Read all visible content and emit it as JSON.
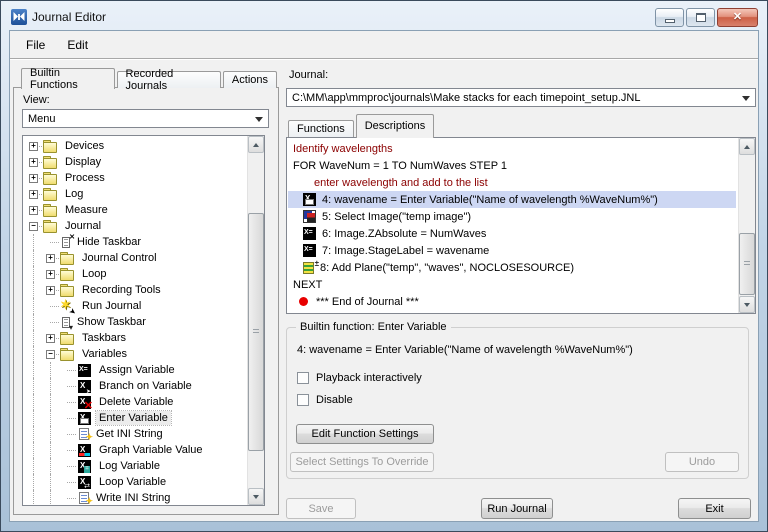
{
  "window": {
    "title": "Journal Editor"
  },
  "menu_bar": {
    "items": [
      "File",
      "Edit"
    ]
  },
  "left_panel": {
    "tabs": [
      {
        "label": "Builtin Functions",
        "active": true
      },
      {
        "label": "Recorded Journals",
        "active": false
      },
      {
        "label": "Actions",
        "active": false
      }
    ],
    "view_label": "View:",
    "view_value": "Menu",
    "tree": [
      {
        "label": "Devices",
        "type": "folder",
        "expand": "+",
        "level": 0
      },
      {
        "label": "Display",
        "type": "folder",
        "expand": "+",
        "level": 0
      },
      {
        "label": "Process",
        "type": "folder",
        "expand": "+",
        "level": 0
      },
      {
        "label": "Log",
        "type": "folder",
        "expand": "+",
        "level": 0
      },
      {
        "label": "Measure",
        "type": "folder",
        "expand": "+",
        "level": 0
      },
      {
        "label": "Journal",
        "type": "folder",
        "expand": "-",
        "level": 0
      },
      {
        "label": "Hide Taskbar",
        "type": "item",
        "icon": "hide-taskbar",
        "level": 1
      },
      {
        "label": "Journal Control",
        "type": "folder",
        "expand": "+",
        "level": 1
      },
      {
        "label": "Loop",
        "type": "folder",
        "expand": "+",
        "level": 1
      },
      {
        "label": "Recording Tools",
        "type": "folder",
        "expand": "+",
        "level": 1
      },
      {
        "label": "Run Journal",
        "type": "item",
        "icon": "run-journal",
        "level": 1
      },
      {
        "label": "Show Taskbar",
        "type": "item",
        "icon": "show-taskbar",
        "level": 1
      },
      {
        "label": "Taskbars",
        "type": "folder",
        "expand": "+",
        "level": 1
      },
      {
        "label": "Variables",
        "type": "folder",
        "expand": "-",
        "level": 1
      },
      {
        "label": "Assign Variable",
        "type": "item",
        "icon": "assign-variable",
        "level": 2
      },
      {
        "label": "Branch on Variable",
        "type": "item",
        "icon": "branch-variable",
        "level": 2
      },
      {
        "label": "Delete Variable",
        "type": "item",
        "icon": "delete-variable",
        "level": 2
      },
      {
        "label": "Enter Variable",
        "type": "item",
        "icon": "enter-variable",
        "level": 2,
        "selected": true
      },
      {
        "label": "Get INI String",
        "type": "item",
        "icon": "get-ini-string",
        "level": 2
      },
      {
        "label": "Graph Variable Value",
        "type": "item",
        "icon": "graph-variable",
        "level": 2
      },
      {
        "label": "Log Variable",
        "type": "item",
        "icon": "log-variable",
        "level": 2
      },
      {
        "label": "Loop Variable",
        "type": "item",
        "icon": "loop-variable",
        "level": 2
      },
      {
        "label": "Write INI String",
        "type": "item",
        "icon": "write-ini-string",
        "level": 2
      }
    ]
  },
  "right_panel": {
    "journal_label": "Journal:",
    "journal_path": "C:\\MM\\app\\mmproc\\journals\\Make stacks for each timepoint_setup.JNL",
    "tabs": [
      {
        "label": "Functions",
        "active": false
      },
      {
        "label": "Descriptions",
        "active": true
      }
    ],
    "steps": [
      {
        "text": "Identify wavelengths",
        "type": "comment",
        "indent": 0
      },
      {
        "text": "FOR WaveNum = 1 TO NumWaves STEP 1",
        "type": "code",
        "indent": 0
      },
      {
        "text": "enter wavelength and add to the list",
        "type": "comment",
        "indent": 1
      },
      {
        "text": "4: wavename = Enter Variable(\"Name of wavelength %WaveNum%\")",
        "type": "step",
        "icon": "enter-variable",
        "indent": 1,
        "selected": true
      },
      {
        "text": "5: Select Image(\"temp image\")",
        "type": "step",
        "icon": "select-image",
        "indent": 1
      },
      {
        "text": "6: Image.ZAbsolute = NumWaves",
        "type": "step",
        "icon": "assign-variable",
        "indent": 1
      },
      {
        "text": "7: Image.StageLabel = wavename",
        "type": "step",
        "icon": "assign-variable",
        "indent": 1
      },
      {
        "text": "8: Add Plane(\"temp\", \"waves\", NOCLOSESOURCE)",
        "type": "step",
        "icon": "add-plane",
        "indent": 1
      },
      {
        "text": "NEXT",
        "type": "code",
        "indent": 0
      },
      {
        "text": "*** End of Journal ***",
        "type": "end",
        "icon": "red-dot",
        "indent": 0
      }
    ],
    "builtin_group": {
      "title": "Builtin function: Enter Variable",
      "function_line": "4: wavename = Enter Variable(\"Name of wavelength %WaveNum%\")",
      "checkboxes": [
        {
          "label": "Playback interactively",
          "checked": false
        },
        {
          "label": "Disable",
          "checked": false
        }
      ],
      "edit_button": "Edit Function Settings",
      "override_button": "Select Settings To Override",
      "undo_button": "Undo"
    },
    "footer": {
      "save": "Save",
      "run": "Run Journal",
      "exit": "Exit"
    }
  },
  "colors": {
    "comment_text": "#8b0000",
    "selection_highlight": "#cdd7f3",
    "close_button_red": "#cd5f45",
    "titlebar_blue": "#c3d5e7"
  }
}
